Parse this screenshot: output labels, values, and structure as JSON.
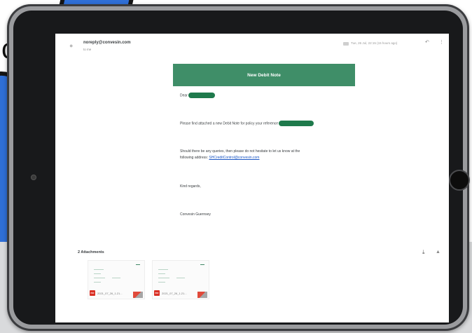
{
  "email": {
    "sender": "noreply@convesin.com",
    "recipient": "to me",
    "timestamp": "Tue, 26 Jul, 22:15 (15 hours ago)",
    "banner_title": "New Debit Note",
    "greeting": "Dear",
    "paragraph1": "Please find attached a new Debit Note for policy your reference",
    "paragraph2_line1": "Should there be any queries, then please do not hesitate to let us know at the",
    "paragraph2_line2": "following address:",
    "contact_email": "SHCreditControl@convesin.com",
    "closing": "Kind regards,",
    "signature": "Convesin Guernsey"
  },
  "attachments": {
    "title": "2 Attachments",
    "files": [
      {
        "filename": "2021_07_26_1.21...",
        "type": "PDF"
      },
      {
        "filename": "2021_07_26_1.21...",
        "type": "PDF"
      }
    ]
  },
  "icons": {
    "reply": "reply-icon",
    "more": "more-vertical-icon",
    "download": "download-icon",
    "drive": "add-to-drive-icon"
  },
  "colors": {
    "banner": "#3f8e68",
    "redaction": "#1f7a4c",
    "link": "#1a56c4",
    "pdf": "#d93025"
  }
}
